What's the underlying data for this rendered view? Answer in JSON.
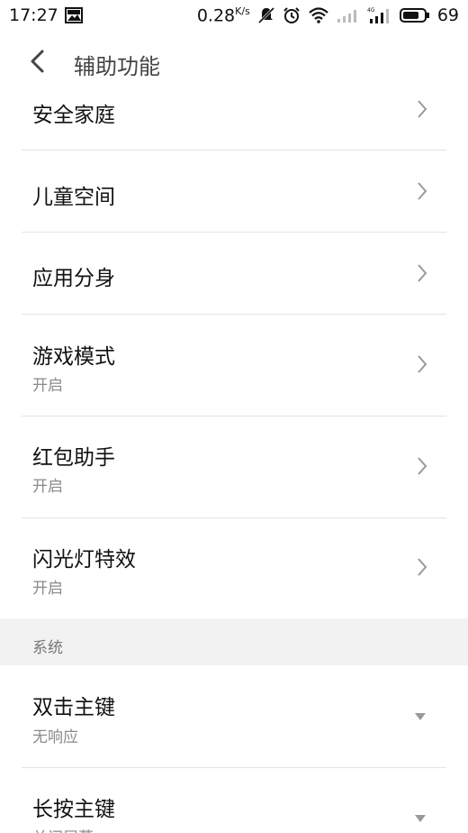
{
  "status_bar": {
    "time": "17:27",
    "speed_value": "0.28",
    "speed_unit": "K/s",
    "battery": "69"
  },
  "header": {
    "title": "辅助功能"
  },
  "items": [
    {
      "title": "安全家庭",
      "subtitle": ""
    },
    {
      "title": "儿童空间",
      "subtitle": ""
    },
    {
      "title": "应用分身",
      "subtitle": ""
    },
    {
      "title": "游戏模式",
      "subtitle": "开启"
    },
    {
      "title": "红包助手",
      "subtitle": "开启"
    },
    {
      "title": "闪光灯特效",
      "subtitle": "开启"
    }
  ],
  "section": {
    "label": "系统"
  },
  "system_items": [
    {
      "title": "双击主键",
      "subtitle": "无响应"
    },
    {
      "title": "长按主键",
      "subtitle": "关闭屏幕"
    }
  ]
}
